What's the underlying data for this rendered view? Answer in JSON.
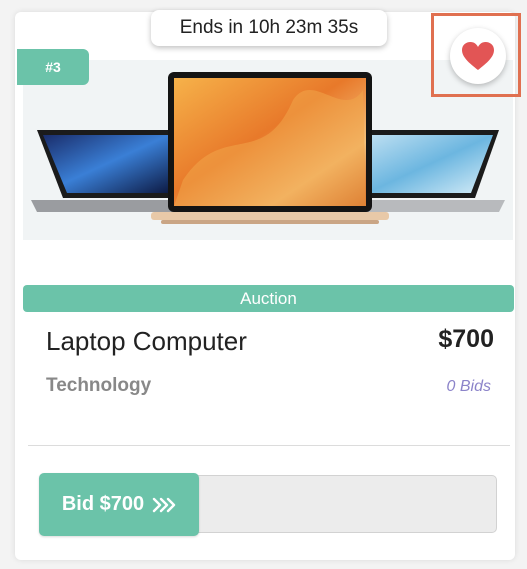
{
  "timer": {
    "text": "Ends in 10h 23m 35s"
  },
  "rank": {
    "label": "#3"
  },
  "favorite": {
    "icon": "heart-icon",
    "color": "#e25555"
  },
  "product": {
    "badge": "Auction",
    "title": "Laptop Computer",
    "price": "$700",
    "category": "Technology",
    "bids": "0 Bids"
  },
  "bid": {
    "label": "Bid $700",
    "icon": "triple-chevron-right-icon"
  },
  "colors": {
    "accent": "#6bc3a9",
    "bids_text": "#8b83c9",
    "highlight": "#e07050"
  }
}
